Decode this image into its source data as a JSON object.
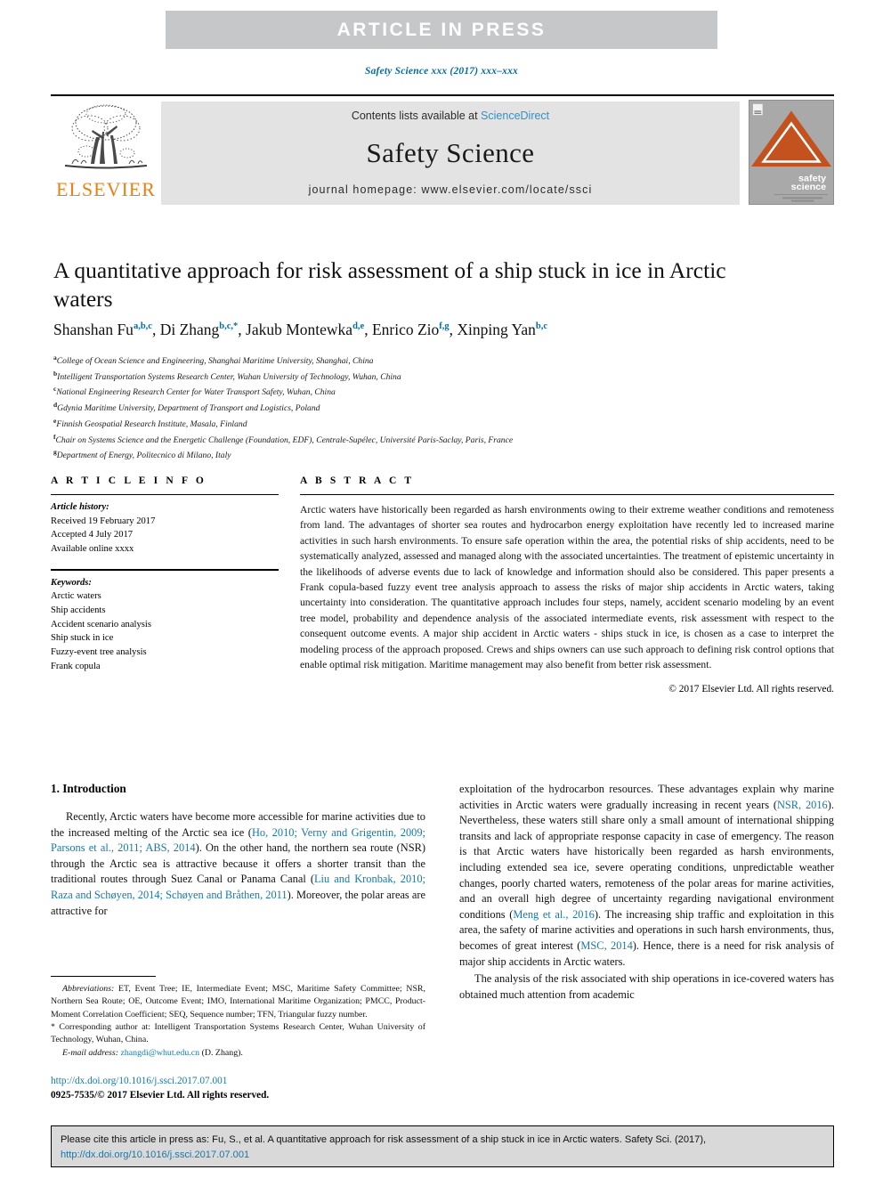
{
  "banner": {
    "text": "ARTICLE  IN  PRESS"
  },
  "running_head": {
    "text": "Safety Science xxx (2017) xxx–xxx"
  },
  "masthead": {
    "contents_prefix": "Contents lists available at ",
    "sciencedirect": "ScienceDirect",
    "journal_title": "Safety Science",
    "homepage": "journal homepage: www.elsevier.com/locate/ssci",
    "publisher_wordmark": "ELSEVIER",
    "cover_line1": "safety",
    "cover_line2": "science"
  },
  "article": {
    "title": "A quantitative approach for risk assessment of a ship stuck in ice in Arctic waters",
    "authors": [
      {
        "name": "Shanshan Fu",
        "sup": "a,b,c"
      },
      {
        "name": "Di Zhang",
        "sup": "b,c,*"
      },
      {
        "name": "Jakub Montewka",
        "sup": "d,e"
      },
      {
        "name": "Enrico Zio",
        "sup": "f,g"
      },
      {
        "name": "Xinping Yan",
        "sup": "b,c"
      }
    ],
    "affiliations": [
      {
        "mark": "a",
        "text": "College of Ocean Science and Engineering, Shanghai Maritime University, Shanghai, China"
      },
      {
        "mark": "b",
        "text": "Intelligent Transportation Systems Research Center, Wuhan University of Technology, Wuhan, China"
      },
      {
        "mark": "c",
        "text": "National Engineering Research Center for Water Transport Safety, Wuhan, China"
      },
      {
        "mark": "d",
        "text": "Gdynia Maritime University, Department of Transport and Logistics, Poland"
      },
      {
        "mark": "e",
        "text": "Finnish Geospatial Research Institute, Masala, Finland"
      },
      {
        "mark": "f",
        "text": "Chair on Systems Science and the Energetic Challenge (Foundation, EDF), Centrale-Supélec, Université Paris-Saclay, Paris, France"
      },
      {
        "mark": "g",
        "text": "Department of Energy, Politecnico di Milano, Italy"
      }
    ]
  },
  "article_info": {
    "heading": "A R T I C L E   I N F O",
    "history_label": "Article history:",
    "history": [
      "Received 19 February 2017",
      "Accepted 4 July 2017",
      "Available online xxxx"
    ],
    "keywords_label": "Keywords:",
    "keywords": [
      "Arctic waters",
      "Ship accidents",
      "Accident scenario analysis",
      "Ship stuck in ice",
      "Fuzzy-event tree analysis",
      "Frank copula"
    ]
  },
  "abstract": {
    "heading": "A B S T R A C T",
    "text": "Arctic waters have historically been regarded as harsh environments owing to their extreme weather conditions and remoteness from land. The advantages of shorter sea routes and hydrocarbon energy exploitation have recently led to increased marine activities in such harsh environments. To ensure safe operation within the area, the potential risks of ship accidents, need to be systematically analyzed, assessed and managed along with the associated uncertainties. The treatment of epistemic uncertainty in the likelihoods of adverse events due to lack of knowledge and information should also be considered. This paper presents a Frank copula-based fuzzy event tree analysis approach to assess the risks of major ship accidents in Arctic waters, taking uncertainty into consideration. The quantitative approach includes four steps, namely, accident scenario modeling by an event tree model, probability and dependence analysis of the associated intermediate events, risk assessment with respect to the consequent outcome events. A major ship accident in Arctic waters - ships stuck in ice, is chosen as a case to interpret the modeling process of the approach proposed. Crews and ships owners can use such approach to defining risk control options that enable optimal risk mitigation. Maritime management may also benefit from better risk assessment.",
    "copyright": "© 2017 Elsevier Ltd. All rights reserved."
  },
  "introduction": {
    "section_title": "1. Introduction",
    "left_para1_a": "Recently, Arctic waters have become more accessible for marine activities due to the increased melting of the Arctic sea ice (",
    "left_cite1": "Ho, 2010; Verny and Grigentin, 2009; Parsons et al., 2011; ABS, 2014",
    "left_para1_b": "). On the other hand, the northern sea route (NSR) through the Arctic sea is attractive because it offers a shorter transit than the traditional routes through Suez Canal or Panama Canal (",
    "left_cite2": "Liu and Kronbak, 2010; Raza and Schøyen, 2014; Schøyen and Bråthen, 2011",
    "left_para1_c": "). Moreover, the polar areas are attractive for",
    "right_para1_a": "exploitation of the hydrocarbon resources. These advantages explain why marine activities in Arctic waters were gradually increasing in recent years (",
    "right_cite1": "NSR, 2016",
    "right_para1_b": "). Nevertheless, these waters still share only a small amount of international shipping transits and lack of appropriate response capacity in case of emergency. The reason is that Arctic waters have historically been regarded as harsh environments, including extended sea ice, severe operating conditions, unpredictable weather changes, poorly charted waters, remoteness of the polar areas for marine activities, and an overall high degree of uncertainty regarding navigational environment conditions (",
    "right_cite2": "Meng et al., 2016",
    "right_para1_c": "). The increasing ship traffic and exploitation in this area, the safety of marine activities and operations in such harsh environments, thus, becomes of great interest (",
    "right_cite3": "MSC, 2014",
    "right_para1_d": "). Hence, there is a need for risk analysis of major ship accidents in Arctic waters.",
    "right_para2": "The analysis of the risk associated with ship operations in ice-covered waters has obtained much attention from academic"
  },
  "footnotes": {
    "abbrev_label": "Abbreviations:",
    "abbrev_text": " ET, Event Tree; IE, Intermediate Event; MSC, Maritime Safety Committee; NSR, Northern Sea Route; OE, Outcome Event; IMO, International Maritime Organization; PMCC, Product-Moment Correlation Coefficient; SEQ, Sequence number; TFN, Triangular fuzzy number.",
    "corresponding": "* Corresponding author at: Intelligent Transportation Systems Research Center, Wuhan University of Technology, Wuhan, China.",
    "email_label": "E-mail address:",
    "email": "zhangdi@whut.edu.cn",
    "email_suffix": " (D. Zhang).",
    "doi": "http://dx.doi.org/10.1016/j.ssci.2017.07.001",
    "issn_copyright": "0925-7535/© 2017 Elsevier Ltd. All rights reserved."
  },
  "cite_box": {
    "text": "Please cite this article in press as: Fu, S., et al. A quantitative approach for risk assessment of a ship stuck in ice in Arctic waters. Safety Sci. (2017), ",
    "link": "http://dx.doi.org/10.1016/j.ssci.2017.07.001"
  },
  "colors": {
    "banner_bg": "#c6c7c9",
    "link_blue": "#1878a8",
    "elsevier_orange": "#ec8013",
    "journal_block_bg": "#e3e3e3",
    "cover_bg": "#a9a9a9",
    "cover_triangle": "#c4521f"
  }
}
